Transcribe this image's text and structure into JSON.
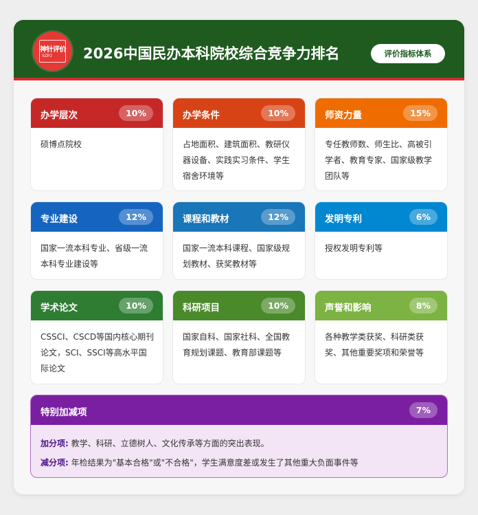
{
  "header": {
    "logo_text": "神针评价",
    "logo_sub": "SZPJ",
    "title": "2026中国民办本科院校综合竞争力排名",
    "button_label": "评价指标体系"
  },
  "colors": {
    "header_bg": "#1f5a1f",
    "header_accent": "#d32f2f",
    "special": "#7b1fa2"
  },
  "tiles": [
    {
      "title": "办学层次",
      "percent": "10%",
      "color": "#c62828",
      "body": "硕博点院校"
    },
    {
      "title": "办学条件",
      "percent": "10%",
      "color": "#d84315",
      "body": "占地面积、建筑面积、教研仪器设备、实践实习条件、学生宿舍环境等"
    },
    {
      "title": "师资力量",
      "percent": "15%",
      "color": "#ef6c00",
      "body": "专任教师数、师生比、高被引学者、教育专家、国家级教学团队等"
    },
    {
      "title": "专业建设",
      "percent": "12%",
      "color": "#1565c0",
      "body": "国家一流本科专业、省级一流本科专业建设等"
    },
    {
      "title": "课程和教材",
      "percent": "12%",
      "color": "#1976b8",
      "body": "国家一流本科课程、国家级规划教材、获奖教材等"
    },
    {
      "title": "发明专利",
      "percent": "6%",
      "color": "#0288d1",
      "body": "授权发明专利等"
    },
    {
      "title": "学术论文",
      "percent": "10%",
      "color": "#2e7d32",
      "body": "CSSCI、CSCD等国内核心期刊论文，SCI、SSCI等高水平国际论文"
    },
    {
      "title": "科研项目",
      "percent": "10%",
      "color": "#4a8a2a",
      "body": "国家自科、国家社科、全国教育规划课题、教育部课题等"
    },
    {
      "title": "声誉和影响",
      "percent": "8%",
      "color": "#7cb342",
      "body": "各种教学类获奖、科研类获奖、其他重要奖项和荣誉等"
    }
  ],
  "special": {
    "title": "特别加减项",
    "percent": "7%",
    "plus_label": "加分项:",
    "plus_text": "教学、科研、立德树人、文化传承等方面的突出表现。",
    "minus_label": "减分项:",
    "minus_text": "年检结果为\"基本合格\"或\"不合格\"，学生满意度差或发生了其他重大负面事件等"
  }
}
